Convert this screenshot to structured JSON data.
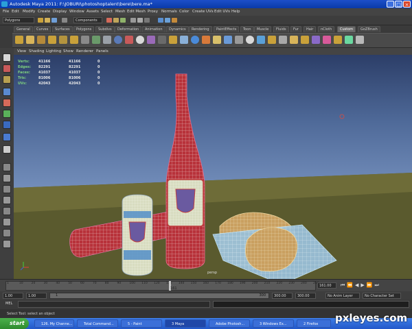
{
  "window": {
    "title": "Autodesk Maya 2011: F:\\JOBURI\\photoshoptalent\\bere\\bere.ma*",
    "controls": [
      "_",
      "□",
      "×"
    ]
  },
  "menubar": {
    "items": [
      "File",
      "Edit",
      "Modify",
      "Create",
      "Display",
      "Window",
      "Assets",
      "Select",
      "Mesh",
      "Edit Mesh",
      "Proxy",
      "Normals",
      "Color",
      "Create UVs",
      "Edit UVs",
      "Help"
    ]
  },
  "statusline": {
    "menuset": "Polygons",
    "selection_mode": "Components"
  },
  "shelf": {
    "tabs": [
      "General",
      "Curves",
      "Surfaces",
      "Polygons",
      "Subdivs",
      "Deformation",
      "Animation",
      "Dynamics",
      "Rendering",
      "PaintEffects",
      "Toon",
      "Muscle",
      "Fluids",
      "Fur",
      "Hair",
      "nCloth",
      "Custom",
      "GoZBrush"
    ],
    "active_tab": "Custom"
  },
  "panel": {
    "menu": [
      "View",
      "Shading",
      "Lighting",
      "Show",
      "Renderer",
      "Panels"
    ],
    "hud": [
      {
        "label": "Verts:",
        "a": "41166",
        "b": "41166",
        "c": "0"
      },
      {
        "label": "Edges:",
        "a": "82291",
        "b": "82291",
        "c": "0"
      },
      {
        "label": "Faces:",
        "a": "41037",
        "b": "41037",
        "c": "0"
      },
      {
        "label": "Tris:",
        "a": "81006",
        "b": "81006",
        "c": "0"
      },
      {
        "label": "UVs:",
        "a": "42043",
        "b": "42043",
        "c": "0"
      }
    ],
    "camera": "persp"
  },
  "timeline": {
    "ticks": [
      "1",
      "10",
      "20",
      "30",
      "40",
      "50",
      "60",
      "70",
      "80",
      "90",
      "100",
      "110",
      "120",
      "130",
      "140",
      "150",
      "160",
      "170",
      "180",
      "190",
      "200",
      "210",
      "220",
      "230",
      "240",
      "250"
    ],
    "current_frame": "161.00",
    "playhead_marker": "161"
  },
  "range": {
    "start": "1.00",
    "inner_start": "1.00",
    "inner_start_box": "1",
    "inner_end_box": "300",
    "inner_end": "300.00",
    "end": "300.00",
    "anim_layer": "No Anim Layer",
    "char_set": "No Character Set"
  },
  "cmdline": {
    "label": "MEL"
  },
  "helpline": {
    "text": "Select Tool: select an object"
  },
  "taskbar": {
    "start": "start",
    "tasks": [
      "126. My Channe...",
      "Total Command...",
      "5 - Paint",
      "3 Maya",
      "Adobe Photosh...",
      "3 Windows Ex...",
      "2 Firefox"
    ],
    "active": "3 Maya"
  },
  "watermark": "pxleyes.com"
}
